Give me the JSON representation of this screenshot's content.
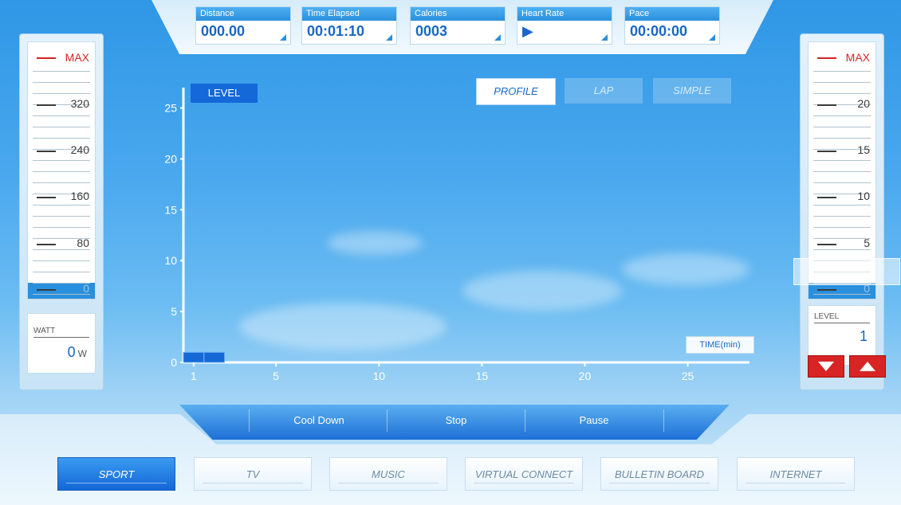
{
  "stats": [
    {
      "label": "Distance",
      "value": "000.00"
    },
    {
      "label": "Time Elapsed",
      "value": "00:01:10"
    },
    {
      "label": "Calories",
      "value": "0003"
    },
    {
      "label": "Heart Rate",
      "value": "▶"
    },
    {
      "label": "Pace",
      "value": "00:00:00"
    }
  ],
  "watt_panel": {
    "max_label": "MAX",
    "scale": [
      "320",
      "240",
      "160",
      "80",
      "0"
    ],
    "readout_label": "WATT",
    "readout_value": "0",
    "readout_unit": "W"
  },
  "level_panel": {
    "max_label": "MAX",
    "scale": [
      "20",
      "15",
      "10",
      "5",
      "0"
    ],
    "readout_label": "LEVEL",
    "readout_value": "1"
  },
  "chart": {
    "level_tag": "LEVEL",
    "time_tag": "TIME(min)",
    "modes": [
      "PROFILE",
      "LAP",
      "SIMPLE"
    ],
    "active_mode": "PROFILE"
  },
  "chart_data": {
    "type": "bar",
    "ylabel": "LEVEL",
    "xlabel": "TIME(min)",
    "ylim": [
      0,
      27
    ],
    "xlim": [
      0.5,
      28
    ],
    "y_ticks": [
      "0",
      "5",
      "10",
      "15",
      "20",
      "25"
    ],
    "x_ticks": [
      "1",
      "5",
      "10",
      "15",
      "20",
      "25"
    ],
    "bars": [
      {
        "x": 1,
        "value": 1
      },
      {
        "x": 2,
        "value": 1
      }
    ]
  },
  "controls": [
    "Cool Down",
    "Stop",
    "Pause"
  ],
  "nav": [
    "SPORT",
    "TV",
    "MUSIC",
    "VIRTUAL CONNECT",
    "BULLETIN BOARD",
    "INTERNET"
  ],
  "nav_active": "SPORT",
  "colors": {
    "accent": "#1468d8",
    "max_red": "#d42424",
    "arrow_red": "#d82424"
  },
  "icons": {
    "level_down": "triangle-down-icon",
    "level_up": "triangle-up-icon"
  }
}
